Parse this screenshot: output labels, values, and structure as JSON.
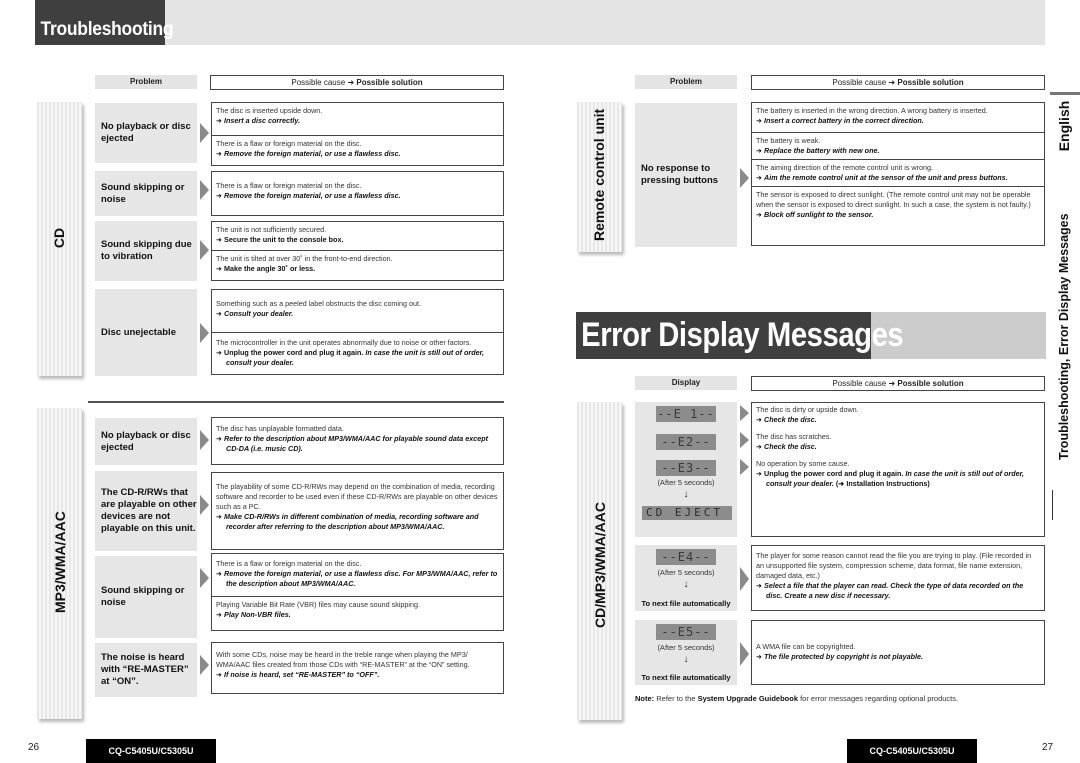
{
  "left_page": {
    "title": "Troubleshooting",
    "header": {
      "problem": "Problem",
      "cause_prefix": "Possible cause",
      "arrow": "➜",
      "solution": "Possible solution"
    },
    "sections": [
      {
        "label": "CD",
        "problems": [
          {
            "problem": "No playback or disc ejected",
            "causes": [
              {
                "cause": "The disc is inserted upside down.",
                "solution_bold": "",
                "solution_italic": "Insert a disc correctly."
              },
              {
                "cause": "There is a flaw or foreign material on the disc.",
                "solution_bold": "",
                "solution_italic": "Remove the foreign material, or use a flawless disc."
              }
            ]
          },
          {
            "problem": "Sound skipping or noise",
            "causes": [
              {
                "cause": "There is a flaw or foreign material on the disc.",
                "solution_bold": "",
                "solution_italic": "Remove the foreign material, or use a flawless disc."
              }
            ]
          },
          {
            "problem": "Sound skipping due to vibration",
            "causes": [
              {
                "cause": "The unit is not sufficiently secured.",
                "solution_bold": "Secure the unit to the console box.",
                "solution_italic": ""
              },
              {
                "cause": "The unit is tilted at over 30˚ in the front-to-end direction.",
                "solution_bold": "Make the angle 30˚ or less.",
                "solution_italic": ""
              }
            ]
          },
          {
            "problem": "Disc unejectable",
            "causes": [
              {
                "cause": "Something such as a peeled label obstructs the disc coming out.",
                "solution_bold": "",
                "solution_italic": "Consult your dealer."
              },
              {
                "cause": "The microcontroller in the unit operates abnormally due to noise or other factors.",
                "solution_bold": "Unplug the power cord and plug it again.",
                "solution_italic": "In case the unit is still out of order, consult your dealer."
              }
            ]
          }
        ]
      },
      {
        "label": "MP3/WMA/AAC",
        "problems": [
          {
            "problem": "No playback or disc ejected",
            "causes": [
              {
                "cause": "The disc has unplayable formatted data.",
                "solution_bold": "",
                "solution_italic": "Refer to the description about MP3/WMA/AAC for playable sound data except CD-DA (i.e. music CD)."
              }
            ]
          },
          {
            "problem": "The CD-R/RWs that are playable on other devices are not playable on this unit.",
            "causes": [
              {
                "cause": "The playability of some CD-R/RWs may depend on the combination of media, recording software and recorder to be used even if these CD-R/RWs are playable on other devices such as a PC.",
                "solution_bold": "",
                "solution_italic": "Make CD-R/RWs in different combination of media, recording software and recorder after referring to the description about MP3/WMA/AAC."
              }
            ]
          },
          {
            "problem": "Sound skipping or noise",
            "causes": [
              {
                "cause": "There is a flaw or foreign material on the disc.",
                "solution_bold": "",
                "solution_italic": "Remove the foreign material, or use a flawless disc. For MP3/WMA/AAC, refer to the description about MP3/WMA/AAC."
              },
              {
                "cause": "Playing Variable Bit Rate (VBR) files may cause sound skipping.",
                "solution_bold": "",
                "solution_italic": "Play Non-VBR files."
              }
            ]
          },
          {
            "problem": "The noise is heard with “RE-MASTER” at “ON”.",
            "causes": [
              {
                "cause": "With some CDs, noise may be heard in the treble range when playing the MP3/ WMA/AAC files created from those CDs with “RE-MASTER” at the “ON” setting.",
                "solution_bold": "",
                "solution_italic": "If noise is heard, set “RE-MASTER” to “OFF”."
              }
            ]
          }
        ]
      }
    ],
    "footer": {
      "page_number": "26",
      "model": "CQ-C5405U/C5305U"
    }
  },
  "right_page": {
    "header": {
      "problem": "Problem",
      "cause_prefix": "Possible cause",
      "arrow": "➜",
      "solution": "Possible solution"
    },
    "remote_section": {
      "label": "Remote control unit",
      "problem": "No response to pressing buttons",
      "causes": [
        {
          "cause": "The battery is inserted in the wrong direction. A wrong battery is inserted.",
          "solution_italic": "Insert a correct battery in the correct direction."
        },
        {
          "cause": "The battery is weak.",
          "solution_italic": "Replace the battery with new one."
        },
        {
          "cause": "The aiming direction of the remote control unit is wrong.",
          "solution_italic": "Aim the remote control unit at the sensor of the unit and press buttons."
        },
        {
          "cause": "The sensor is exposed to direct sunlight. (The remote control unit may not be operable when the sensor is exposed to direct sunlight. In such a case, the system is not faulty.)",
          "solution_italic": "Block off sunlight to the sensor."
        }
      ]
    },
    "error_title": "Error Display Messages",
    "error_header": {
      "display": "Display",
      "cause_prefix": "Possible cause",
      "arrow": "➜",
      "solution": "Possible solution"
    },
    "error_section": {
      "label": "CD/MP3/WMA/AAC",
      "group1": {
        "displays": [
          "--E 1--",
          "--E2--",
          "--E3--"
        ],
        "after": "(After 5 seconds)",
        "result_display": "CD EJECT",
        "causes": [
          {
            "cause": "The disc is dirty or upside down.",
            "solution_bold": "",
            "solution_italic": "Check the disc.",
            "extra": ""
          },
          {
            "cause": "The disc has scratches.",
            "solution_bold": "",
            "solution_italic": "Check the disc.",
            "extra": ""
          },
          {
            "cause": "No operation by some cause.",
            "solution_bold": "Unplug the power cord and plug it again.",
            "solution_italic": "In case the unit is still out of order, consult your dealer.",
            "extra": "(➜ Installation Instructions)"
          }
        ]
      },
      "group2": {
        "display": "--E4--",
        "after": "(After 5 seconds)",
        "result": "To next file automatically",
        "cause": "The player for some reason cannot read the file you are trying to play. (File recorded in an unsupported file system, compression scheme, data format, file name extension, damaged data, etc.)",
        "solution_italic": "Select a file that the player can read. Check the type of data recorded on the disc. Create a new disc if necessary."
      },
      "group3": {
        "display": "--E5--",
        "after": "(After 5 seconds)",
        "result": "To next file automatically",
        "cause": "A WMA file can be copyrighted.",
        "solution_italic": "The file protected by copyright is not playable."
      }
    },
    "note": {
      "label": "Note:",
      "text1": "Refer to the",
      "guide": "System Upgrade Guidebook",
      "text2": "for error messages regarding optional products."
    },
    "side_tab": {
      "language": "English",
      "section": "Troubleshooting, Error Display Messages"
    },
    "footer": {
      "page_number": "27",
      "model": "CQ-C5405U/C5305U"
    }
  }
}
